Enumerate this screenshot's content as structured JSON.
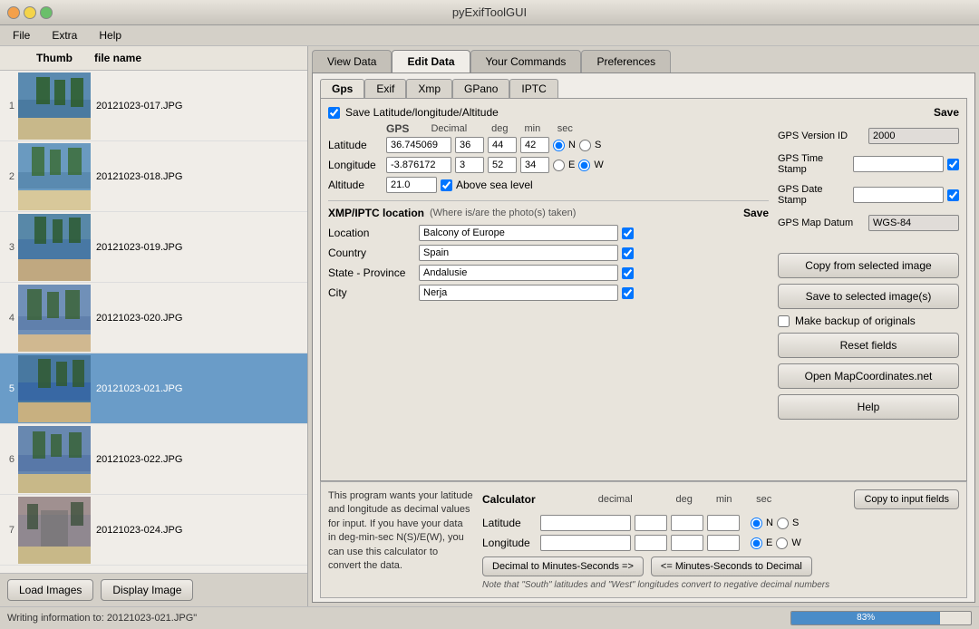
{
  "window": {
    "title": "pyExifToolGUI"
  },
  "menu": {
    "items": [
      "File",
      "Extra",
      "Help"
    ]
  },
  "tabs": {
    "main": [
      "View Data",
      "Edit Data",
      "Your Commands",
      "Preferences"
    ],
    "active_main": "Edit Data",
    "sub": [
      "Gps",
      "Exif",
      "Xmp",
      "GPano",
      "IPTC"
    ],
    "active_sub": "Gps"
  },
  "gps": {
    "save_lat_label": "Save Latitude/longitude/Altitude",
    "label": "GPS",
    "col_decimal": "Decimal",
    "col_deg": "deg",
    "col_min": "min",
    "col_sec": "sec",
    "latitude_label": "Latitude",
    "latitude_decimal": "36.745069",
    "latitude_deg": "36",
    "latitude_min": "44",
    "latitude_sec": "42",
    "lat_n": "N",
    "lat_s": "S",
    "longitude_label": "Longitude",
    "longitude_decimal": "-3.876172",
    "longitude_deg": "3",
    "longitude_min": "52",
    "longitude_sec": "34",
    "lon_e": "E",
    "lon_w": "W",
    "altitude_label": "Altitude",
    "altitude_value": "21.0",
    "above_sea_label": "Above sea level",
    "save_label": "Save",
    "version_id_label": "GPS Version ID",
    "version_id_value": "2000",
    "time_stamp_label": "GPS Time Stamp",
    "date_stamp_label": "GPS Date Stamp",
    "map_datum_label": "GPS Map Datum",
    "map_datum_value": "WGS-84"
  },
  "xmp_iptc": {
    "title": "XMP/IPTC location",
    "subtitle": "(Where is/are the photo(s) taken)",
    "save_label": "Save",
    "location_label": "Location",
    "location_value": "Balcony of Europe",
    "country_label": "Country",
    "country_value": "Spain",
    "state_label": "State - Province",
    "state_value": "Andalusie",
    "city_label": "City",
    "city_value": "Nerja"
  },
  "actions": {
    "copy_from": "Copy from selected image",
    "save_to": "Save to selected image(s)",
    "backup_label": "Make backup of originals",
    "reset": "Reset fields",
    "open_map": "Open MapCoordinates.net",
    "help": "Help"
  },
  "calculator": {
    "description": "This program wants your latitude and longitude as decimal values for input. If you have your data in deg-min-sec N(S)/E(W), you can use this calculator to convert the data.",
    "title": "Calculator",
    "col_decimal": "decimal",
    "col_deg": "deg",
    "col_min": "min",
    "col_sec": "sec",
    "copy_btn": "Copy to input fields",
    "lat_label": "Latitude",
    "lon_label": "Longitude",
    "lat_n": "N",
    "lat_s": "S",
    "lon_e": "E",
    "lon_w": "W",
    "decimal_to_dms": "Decimal to Minutes-Seconds =>",
    "dms_to_decimal": "<= Minutes-Seconds to Decimal",
    "note": "Note that \"South\" latitudes and \"West\" longitudes convert to negative decimal numbers"
  },
  "file_list": {
    "col_thumb": "Thumb",
    "col_filename": "file name",
    "files": [
      {
        "num": "1",
        "name": "20121023-017.JPG",
        "selected": false
      },
      {
        "num": "2",
        "name": "20121023-018.JPG",
        "selected": false
      },
      {
        "num": "3",
        "name": "20121023-019.JPG",
        "selected": false
      },
      {
        "num": "4",
        "name": "20121023-020.JPG",
        "selected": false
      },
      {
        "num": "5",
        "name": "20121023-021.JPG",
        "selected": true
      },
      {
        "num": "6",
        "name": "20121023-022.JPG",
        "selected": false
      },
      {
        "num": "7",
        "name": "20121023-024.JPG",
        "selected": false
      }
    ],
    "load_images": "Load Images",
    "display_image": "Display Image"
  },
  "status": {
    "text": "Writing information to: 20121023-021.JPG\"",
    "progress": "83%",
    "progress_pct": 83
  }
}
